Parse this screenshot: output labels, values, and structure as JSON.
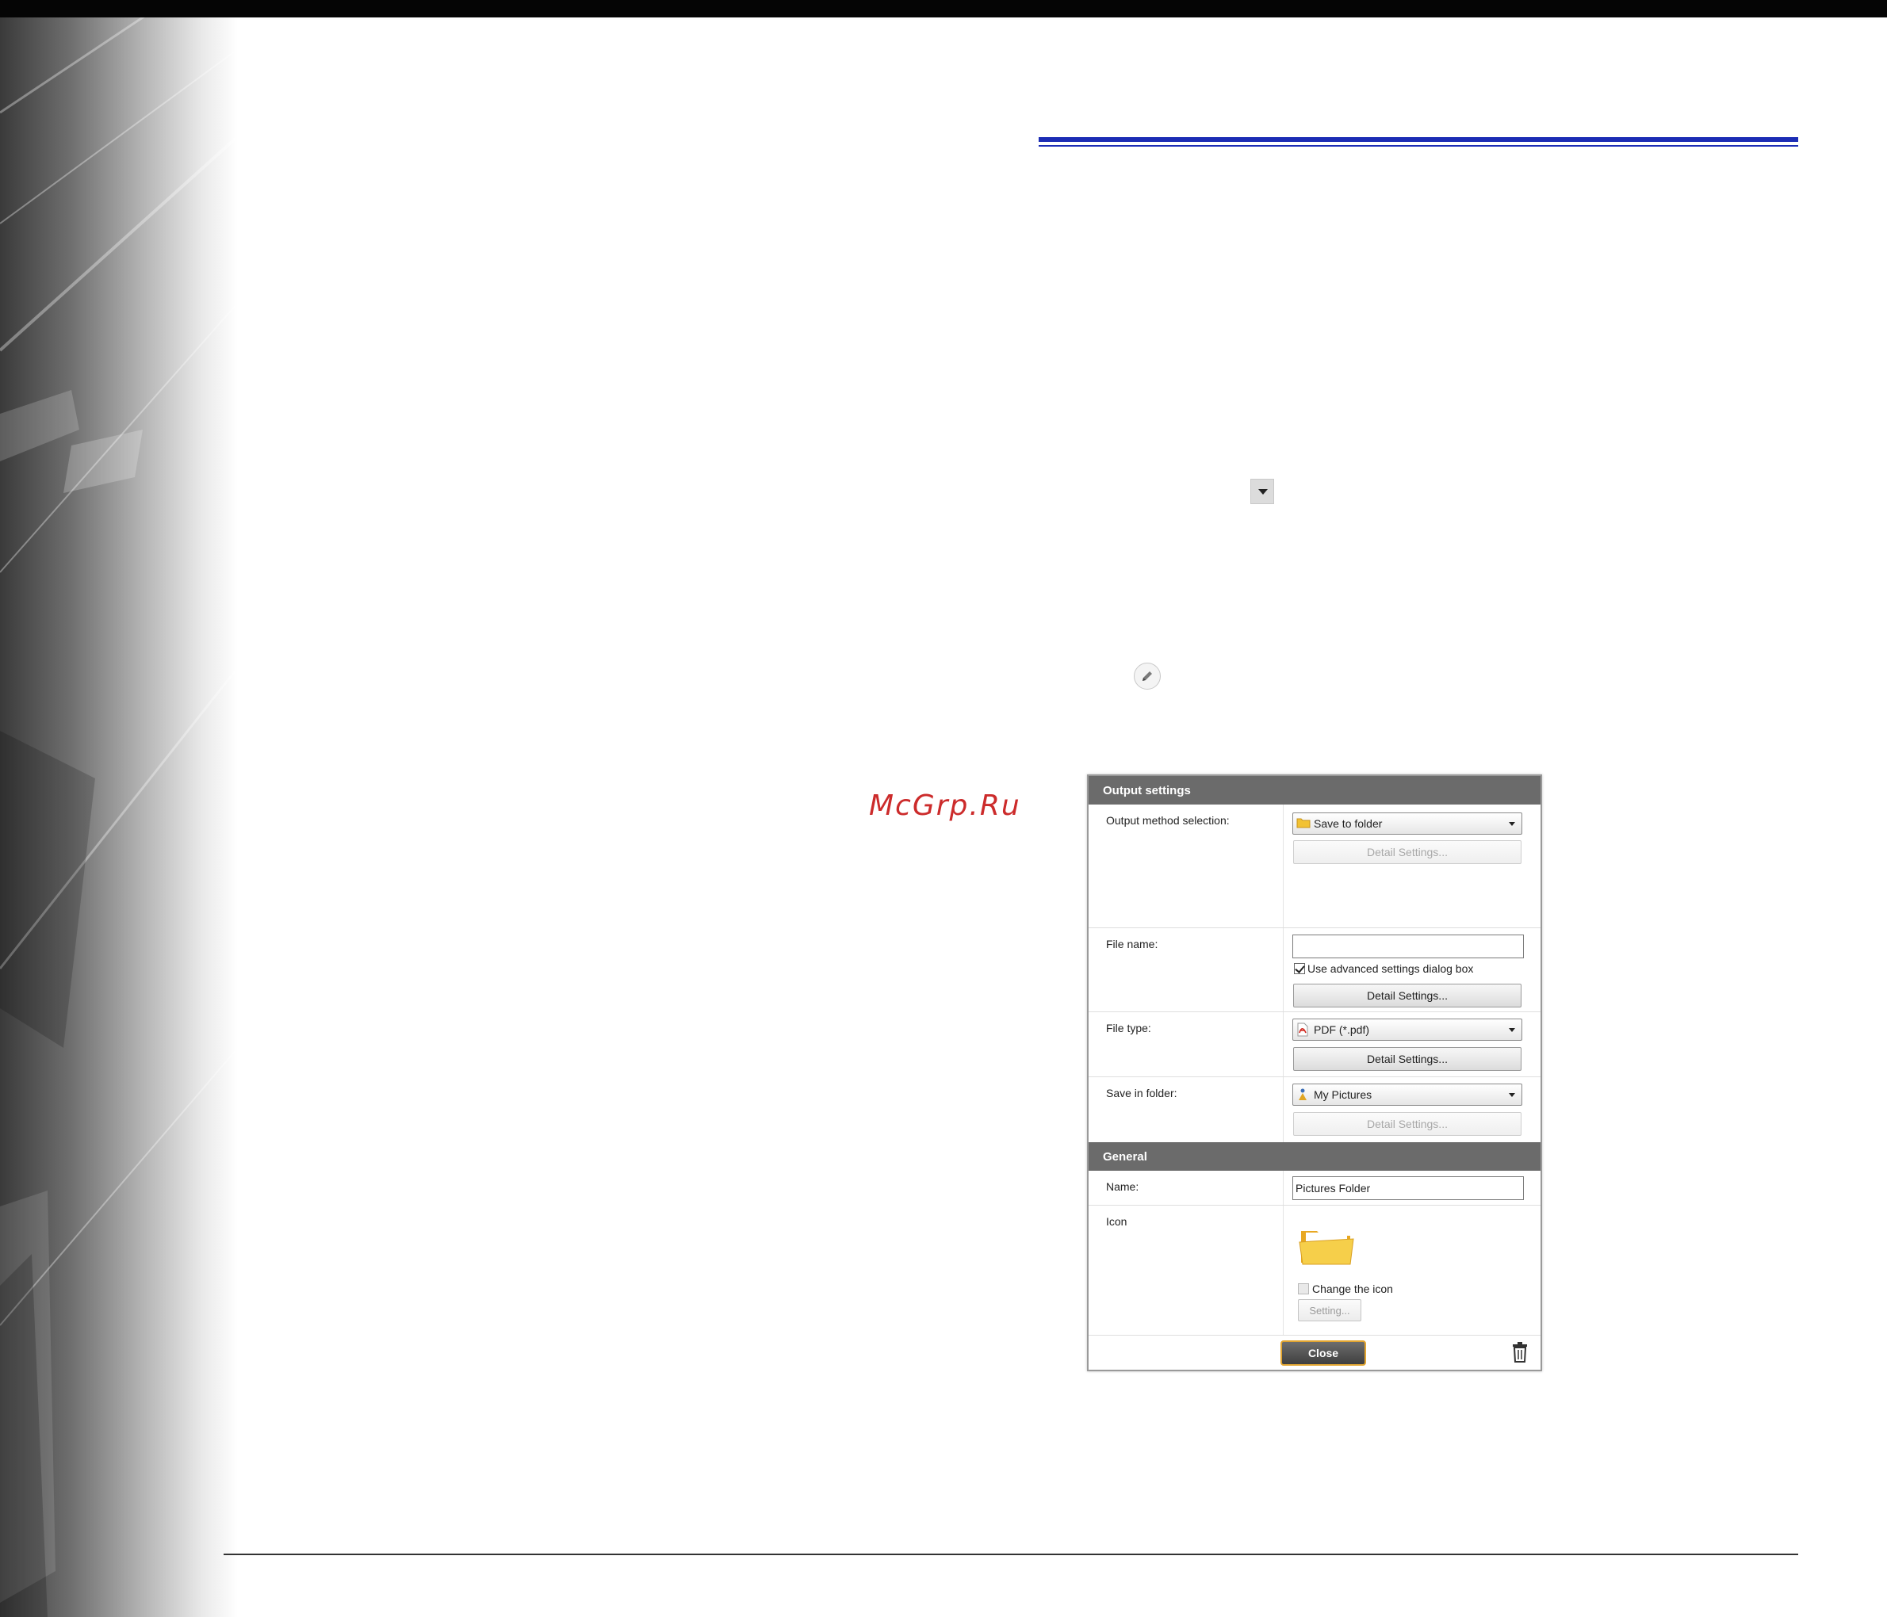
{
  "watermark": {
    "text": "McGrp.Ru"
  },
  "dialog": {
    "output_header": "Output settings",
    "output_method": {
      "label": "Output method selection:",
      "value": "Save to folder",
      "detail_button": "Detail Settings..."
    },
    "file_name": {
      "label": "File name:",
      "value": "",
      "checkbox_label": "Use advanced settings dialog box",
      "checkbox_checked": true,
      "detail_button": "Detail Settings..."
    },
    "file_type": {
      "label": "File type:",
      "value": "PDF (*.pdf)",
      "detail_button": "Detail Settings..."
    },
    "save_in_folder": {
      "label": "Save in folder:",
      "value": "My Pictures",
      "detail_button": "Detail Settings..."
    },
    "general_header": "General",
    "name": {
      "label": "Name:",
      "value": "Pictures Folder"
    },
    "icon": {
      "label": "Icon",
      "checkbox_label": "Change the icon",
      "checkbox_checked": false,
      "setting_button": "Setting..."
    },
    "close_button": "Close"
  },
  "colors": {
    "header_rule": "#1c2db5",
    "section_header": "#6b6b6b",
    "close_border": "#e2a531",
    "watermark": "#cc2b2b"
  },
  "icons": [
    "dropdown-arrow-icon",
    "pencil-edit-icon",
    "folder-icon",
    "pdf-icon",
    "pictures-folder-icon",
    "trash-icon"
  ]
}
